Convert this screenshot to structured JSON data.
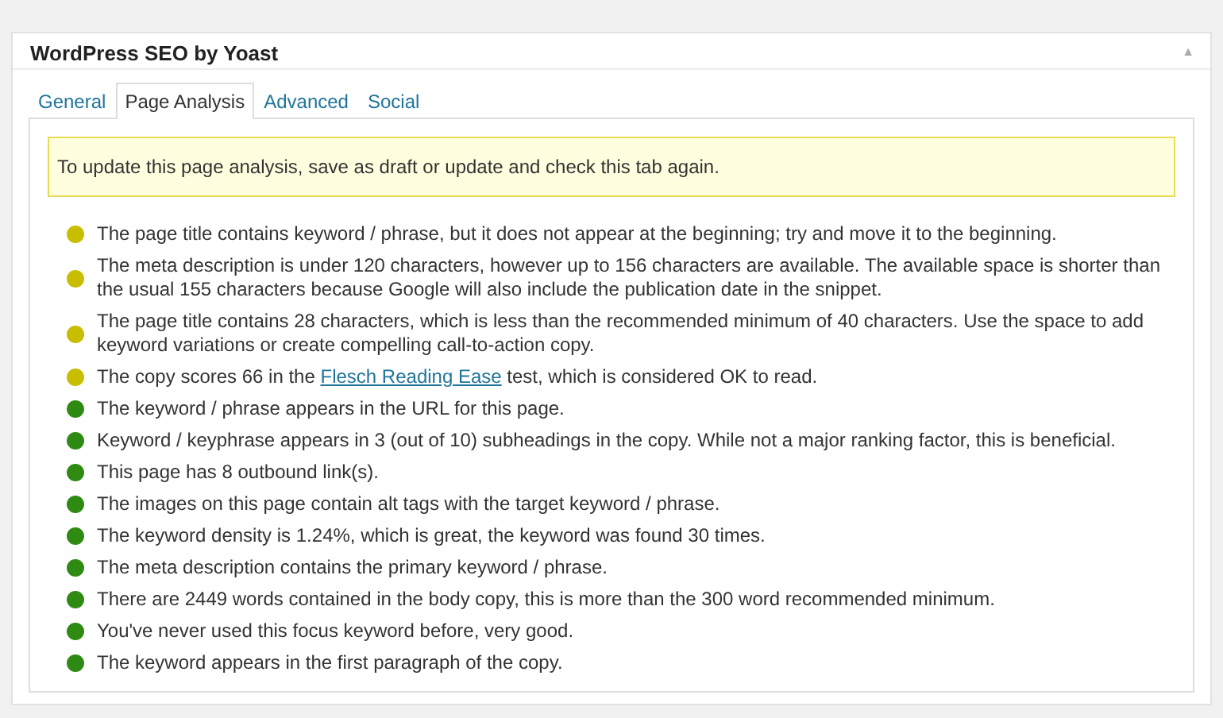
{
  "panel": {
    "title": "WordPress SEO by Yoast",
    "collapse_icon": "▲"
  },
  "tabs": [
    {
      "label": "General",
      "selected": false
    },
    {
      "label": "Page Analysis",
      "selected": true
    },
    {
      "label": "Advanced",
      "selected": false
    },
    {
      "label": "Social",
      "selected": false
    }
  ],
  "notice": "To update this page analysis, save as draft or update and check this tab again.",
  "results": [
    {
      "color": "#c9bd00",
      "text": "The page title contains keyword / phrase, but it does not appear at the beginning; try and move it to the beginning."
    },
    {
      "color": "#c9bd00",
      "text": "The meta description is under 120 characters, however up to 156 characters are available. The available space is shorter than the usual 155 characters because Google will also include the publication date in the snippet."
    },
    {
      "color": "#c9bd00",
      "text": "The page title contains 28 characters, which is less than the recommended minimum of 40 characters. Use the space to add keyword variations or create compelling call-to-action copy."
    },
    {
      "color": "#c9bd00",
      "text": "The copy scores 66 in the ",
      "link": "Flesch Reading Ease",
      "text_after": " test, which is considered OK to read."
    },
    {
      "color": "#2f8a14",
      "text": "The keyword / phrase appears in the URL for this page."
    },
    {
      "color": "#2f8a14",
      "text": "Keyword / keyphrase appears in 3 (out of 10) subheadings in the copy. While not a major ranking factor, this is beneficial."
    },
    {
      "color": "#2f8a14",
      "text": "This page has 8 outbound link(s)."
    },
    {
      "color": "#2f8a14",
      "text": "The images on this page contain alt tags with the target keyword / phrase."
    },
    {
      "color": "#2f8a14",
      "text": "The keyword density is 1.24%, which is great, the keyword was found 30 times."
    },
    {
      "color": "#2f8a14",
      "text": "The meta description contains the primary keyword / phrase."
    },
    {
      "color": "#2f8a14",
      "text": "There are 2449 words contained in the body copy, this is more than the 300 word recommended minimum."
    },
    {
      "color": "#2f8a14",
      "text": "You've never used this focus keyword before, very good."
    },
    {
      "color": "#2f8a14",
      "text": "The keyword appears in the first paragraph of the copy."
    }
  ]
}
